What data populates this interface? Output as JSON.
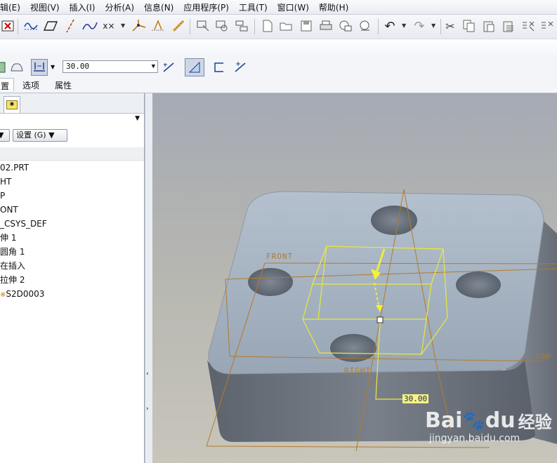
{
  "menu": {
    "items": [
      "辑(E)",
      "视图(V)",
      "插入(I)",
      "分析(A)",
      "信息(N)",
      "应用程序(P)",
      "工具(T)",
      "窗口(W)",
      "帮助(H)"
    ]
  },
  "toolbar": {
    "icons": [
      "close-box-icon",
      "sketch-curve-icon",
      "plane-icon",
      "axis-icon",
      "spline-curve-icon",
      "point-icon",
      "csys-icon",
      "analysis-icon",
      "link-icon",
      "window-icon",
      "find-icon",
      "flow-icon",
      "new-file-icon",
      "open-icon",
      "save-icon",
      "print-icon",
      "mail-icon",
      "send-icon",
      "undo-icon",
      "redo-icon",
      "cut-icon",
      "copy-icon",
      "paste-icon",
      "paste-special-icon",
      "regenerate-icon"
    ]
  },
  "dashboard": {
    "depth_value": "30.00"
  },
  "tabs": {
    "placement_label": "置",
    "options_label": "选项",
    "properties_label": "属性"
  },
  "left_panel": {
    "settings_label": "设置 (G)",
    "tree": [
      "02.PRT",
      "HT",
      "P",
      "ONT",
      "_CSYS_DEF",
      "伸 1",
      "圆角 1",
      "在插入",
      "拉伸 2",
      "S2D0003"
    ]
  },
  "viewport": {
    "labels": {
      "front": "FRONT",
      "right": "RIGHT",
      "top": "TOP",
      "dimension": "30.00"
    },
    "colors": {
      "part_top": "#a3b0bf",
      "part_side": "#6d737c",
      "datum": "#b37a2a",
      "preview": "#e9e93a"
    }
  },
  "watermark": {
    "brand": "Bai",
    "brand2": "du",
    "chinese": "经验",
    "url": "jingyan.baidu.com"
  }
}
